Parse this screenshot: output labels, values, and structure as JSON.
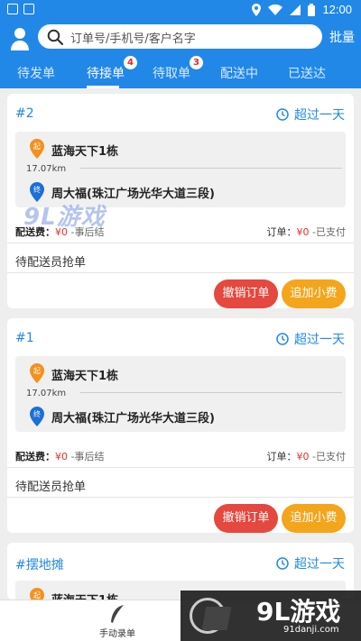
{
  "status_bar": {
    "time": "12:00"
  },
  "header": {
    "search_placeholder": "订单号/手机号/客户名字",
    "batch_label": "批量"
  },
  "tabs": [
    {
      "label": "待发单",
      "badge": ""
    },
    {
      "label": "待接单",
      "badge": "4",
      "active": true
    },
    {
      "label": "待取单",
      "badge": "3"
    },
    {
      "label": "配送中",
      "badge": ""
    },
    {
      "label": "已送达",
      "badge": ""
    }
  ],
  "orders": [
    {
      "number": "#2",
      "time": "超过一天",
      "from_tag": "起",
      "from_address": "蓝海天下1栋",
      "distance": "17.07km",
      "to_tag": "终",
      "to_address": "周大福(珠江广场光华大道三段)",
      "delivery_fee_label": "配送费：",
      "delivery_fee_value": "¥0",
      "delivery_fee_note": "-事后结",
      "order_fee_label": "订单：",
      "order_fee_value": "¥0",
      "order_fee_note": "-已支付",
      "status": "待配送员抢单",
      "cancel_label": "撤销订单",
      "tip_label": "追加小费"
    },
    {
      "number": "#1",
      "time": "超过一天",
      "from_tag": "起",
      "from_address": "蓝海天下1栋",
      "distance": "17.07km",
      "to_tag": "终",
      "to_address": "周大福(珠江广场光华大道三段)",
      "delivery_fee_label": "配送费：",
      "delivery_fee_value": "¥0",
      "delivery_fee_note": "-事后结",
      "order_fee_label": "订单：",
      "order_fee_value": "¥0",
      "order_fee_note": "-已支付",
      "status": "待配送员抢单",
      "cancel_label": "撤销订单",
      "tip_label": "追加小费"
    },
    {
      "number": "#摆地摊",
      "time": "超过一天",
      "from_tag": "起",
      "from_address": "蓝海天下1栋"
    }
  ],
  "bottom_bar": {
    "manual_entry_label": "手动录单"
  },
  "watermark": {
    "brand": "9L游戏",
    "site": "91danji.com"
  },
  "colors": {
    "primary": "#2188e8",
    "cancel": "#e5483e",
    "tip": "#f4a51c",
    "price": "#e8322a"
  }
}
